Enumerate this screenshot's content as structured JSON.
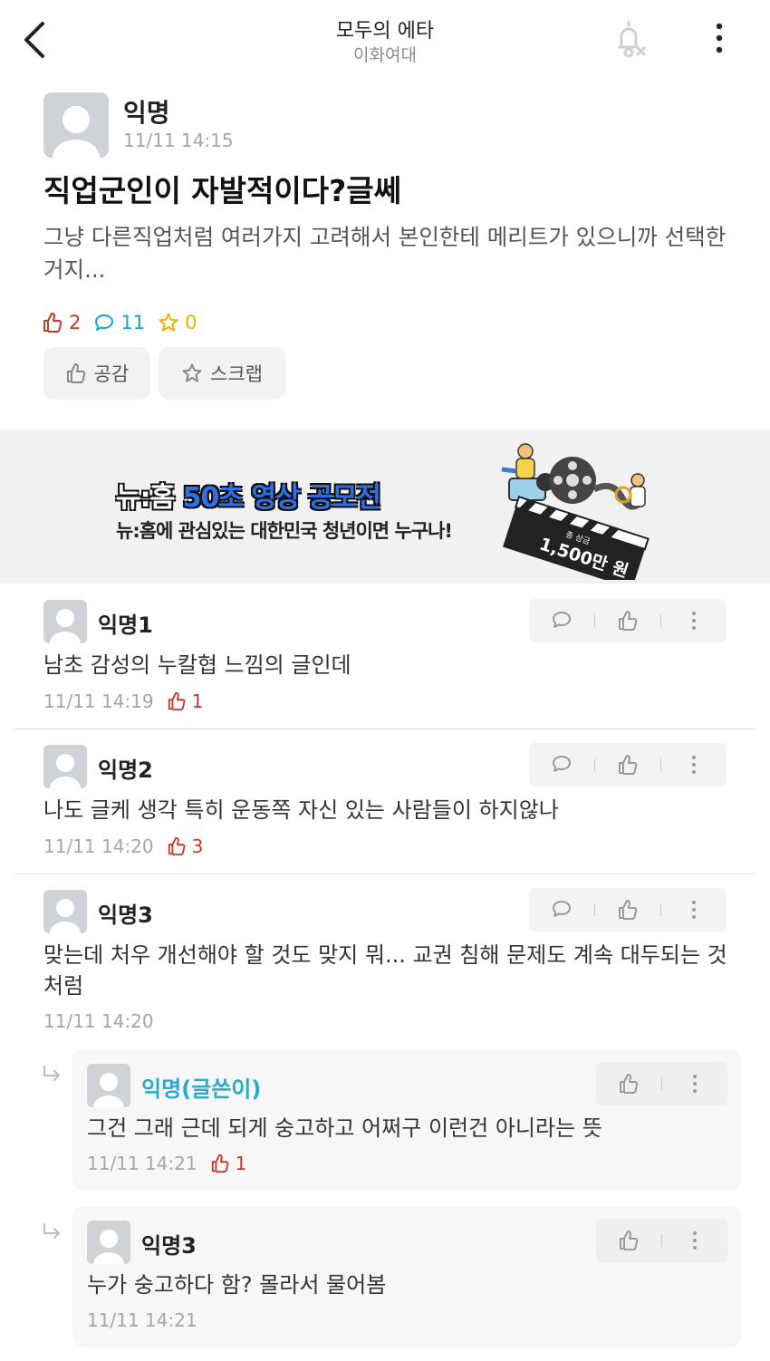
{
  "header": {
    "title": "모두의 에타",
    "subtitle": "이화여대",
    "back_icon": "chevron-left-icon",
    "notification_icon": "bell-off-icon",
    "more_icon": "more-vertical-icon"
  },
  "post": {
    "author": "익명",
    "time": "11/11 14:15",
    "title": "직업군인이 자발적이다?글쎄",
    "body": "그냥 다른직업처럼 여러가지 고려해서 본인한테 메리트가 있으니까 선택한거지...",
    "stats": {
      "likes": "2",
      "comments": "11",
      "scraps": "0"
    },
    "like_button": "공감",
    "scrap_button": "스크랩"
  },
  "ad": {
    "title_part1": "뉴:홈",
    "title_part2": "50초 영상 공모전",
    "subtitle": "뉴:홈에 관심있는 대한민국 청년이면 누구나!",
    "prize_label": "총 상금",
    "prize_amount": "1,500만 원"
  },
  "comments": [
    {
      "author": "익명1",
      "text": "남초 감성의 누칼협 느낌의 글인데",
      "time": "11/11 14:19",
      "likes": "1"
    },
    {
      "author": "익명2",
      "text": "나도 글케 생각 특히 운동쪽 자신 있는 사람들이 하지않나",
      "time": "11/11 14:20",
      "likes": "3"
    },
    {
      "author": "익명3",
      "text": "맞는데 처우 개선해야 할 것도 맞지 뭐... 교권 침해 문제도 계속 대두되는 것 처럼",
      "time": "11/11 14:20",
      "likes": ""
    }
  ],
  "replies": [
    {
      "author": "익명(글쓴이)",
      "text": "그건 그래 근데 되게 숭고하고 어쩌구 이런건 아니라는 뜻",
      "time": "11/11 14:21",
      "likes": "1"
    },
    {
      "author": "익명3",
      "text": "누가 숭고하다 함? 몰라서 물어봄",
      "time": "11/11 14:21",
      "likes": ""
    }
  ],
  "colors": {
    "like_red": "#c43a2a",
    "comment_cyan": "#1aa3d1",
    "scrap_yellow": "#f0b000",
    "op_author": "#2aa9c9"
  }
}
